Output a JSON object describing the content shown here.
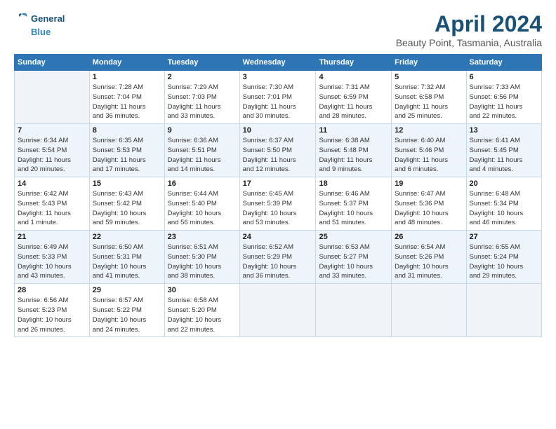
{
  "header": {
    "logo_line1": "General",
    "logo_line2": "Blue",
    "title": "April 2024",
    "subtitle": "Beauty Point, Tasmania, Australia"
  },
  "days_of_week": [
    "Sunday",
    "Monday",
    "Tuesday",
    "Wednesday",
    "Thursday",
    "Friday",
    "Saturday"
  ],
  "weeks": [
    [
      {
        "day": "",
        "info": ""
      },
      {
        "day": "1",
        "info": "Sunrise: 7:28 AM\nSunset: 7:04 PM\nDaylight: 11 hours\nand 36 minutes."
      },
      {
        "day": "2",
        "info": "Sunrise: 7:29 AM\nSunset: 7:03 PM\nDaylight: 11 hours\nand 33 minutes."
      },
      {
        "day": "3",
        "info": "Sunrise: 7:30 AM\nSunset: 7:01 PM\nDaylight: 11 hours\nand 30 minutes."
      },
      {
        "day": "4",
        "info": "Sunrise: 7:31 AM\nSunset: 6:59 PM\nDaylight: 11 hours\nand 28 minutes."
      },
      {
        "day": "5",
        "info": "Sunrise: 7:32 AM\nSunset: 6:58 PM\nDaylight: 11 hours\nand 25 minutes."
      },
      {
        "day": "6",
        "info": "Sunrise: 7:33 AM\nSunset: 6:56 PM\nDaylight: 11 hours\nand 22 minutes."
      }
    ],
    [
      {
        "day": "7",
        "info": "Sunrise: 6:34 AM\nSunset: 5:54 PM\nDaylight: 11 hours\nand 20 minutes."
      },
      {
        "day": "8",
        "info": "Sunrise: 6:35 AM\nSunset: 5:53 PM\nDaylight: 11 hours\nand 17 minutes."
      },
      {
        "day": "9",
        "info": "Sunrise: 6:36 AM\nSunset: 5:51 PM\nDaylight: 11 hours\nand 14 minutes."
      },
      {
        "day": "10",
        "info": "Sunrise: 6:37 AM\nSunset: 5:50 PM\nDaylight: 11 hours\nand 12 minutes."
      },
      {
        "day": "11",
        "info": "Sunrise: 6:38 AM\nSunset: 5:48 PM\nDaylight: 11 hours\nand 9 minutes."
      },
      {
        "day": "12",
        "info": "Sunrise: 6:40 AM\nSunset: 5:46 PM\nDaylight: 11 hours\nand 6 minutes."
      },
      {
        "day": "13",
        "info": "Sunrise: 6:41 AM\nSunset: 5:45 PM\nDaylight: 11 hours\nand 4 minutes."
      }
    ],
    [
      {
        "day": "14",
        "info": "Sunrise: 6:42 AM\nSunset: 5:43 PM\nDaylight: 11 hours\nand 1 minute."
      },
      {
        "day": "15",
        "info": "Sunrise: 6:43 AM\nSunset: 5:42 PM\nDaylight: 10 hours\nand 59 minutes."
      },
      {
        "day": "16",
        "info": "Sunrise: 6:44 AM\nSunset: 5:40 PM\nDaylight: 10 hours\nand 56 minutes."
      },
      {
        "day": "17",
        "info": "Sunrise: 6:45 AM\nSunset: 5:39 PM\nDaylight: 10 hours\nand 53 minutes."
      },
      {
        "day": "18",
        "info": "Sunrise: 6:46 AM\nSunset: 5:37 PM\nDaylight: 10 hours\nand 51 minutes."
      },
      {
        "day": "19",
        "info": "Sunrise: 6:47 AM\nSunset: 5:36 PM\nDaylight: 10 hours\nand 48 minutes."
      },
      {
        "day": "20",
        "info": "Sunrise: 6:48 AM\nSunset: 5:34 PM\nDaylight: 10 hours\nand 46 minutes."
      }
    ],
    [
      {
        "day": "21",
        "info": "Sunrise: 6:49 AM\nSunset: 5:33 PM\nDaylight: 10 hours\nand 43 minutes."
      },
      {
        "day": "22",
        "info": "Sunrise: 6:50 AM\nSunset: 5:31 PM\nDaylight: 10 hours\nand 41 minutes."
      },
      {
        "day": "23",
        "info": "Sunrise: 6:51 AM\nSunset: 5:30 PM\nDaylight: 10 hours\nand 38 minutes."
      },
      {
        "day": "24",
        "info": "Sunrise: 6:52 AM\nSunset: 5:29 PM\nDaylight: 10 hours\nand 36 minutes."
      },
      {
        "day": "25",
        "info": "Sunrise: 6:53 AM\nSunset: 5:27 PM\nDaylight: 10 hours\nand 33 minutes."
      },
      {
        "day": "26",
        "info": "Sunrise: 6:54 AM\nSunset: 5:26 PM\nDaylight: 10 hours\nand 31 minutes."
      },
      {
        "day": "27",
        "info": "Sunrise: 6:55 AM\nSunset: 5:24 PM\nDaylight: 10 hours\nand 29 minutes."
      }
    ],
    [
      {
        "day": "28",
        "info": "Sunrise: 6:56 AM\nSunset: 5:23 PM\nDaylight: 10 hours\nand 26 minutes."
      },
      {
        "day": "29",
        "info": "Sunrise: 6:57 AM\nSunset: 5:22 PM\nDaylight: 10 hours\nand 24 minutes."
      },
      {
        "day": "30",
        "info": "Sunrise: 6:58 AM\nSunset: 5:20 PM\nDaylight: 10 hours\nand 22 minutes."
      },
      {
        "day": "",
        "info": ""
      },
      {
        "day": "",
        "info": ""
      },
      {
        "day": "",
        "info": ""
      },
      {
        "day": "",
        "info": ""
      }
    ]
  ]
}
